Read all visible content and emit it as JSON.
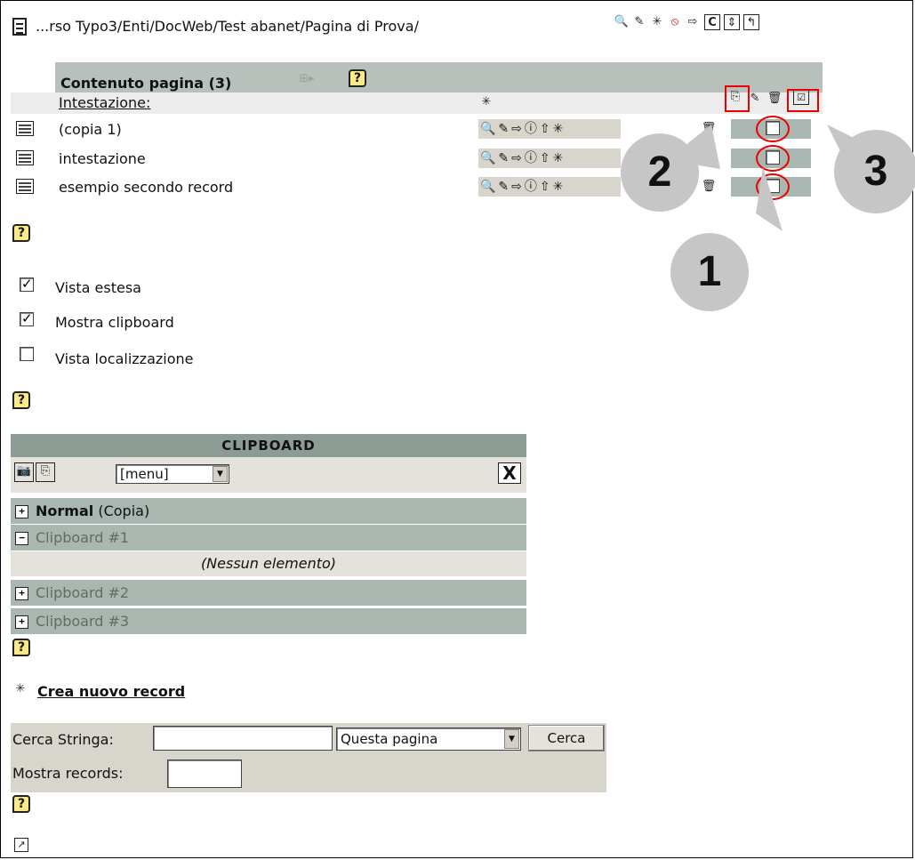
{
  "breadcrumb": {
    "path": "...rso Typo3/Enti/DocWeb/Test abanet/Pagina di Prova/"
  },
  "page_toolbar": {
    "icons": [
      "magnifier-icon",
      "pencil-icon",
      "new-record-icon",
      "edit-disabled-icon",
      "move-icon",
      "clear-cache-icon",
      "refresh-icon",
      "up-level-icon"
    ],
    "clear_cache_label": "C"
  },
  "content_table": {
    "title": "Contenuto pagina (3)",
    "column_header": "Intestazione:",
    "rows": [
      {
        "label": "(copia 1)"
      },
      {
        "label": "intestazione"
      },
      {
        "label": "esempio secondo record"
      }
    ]
  },
  "options": {
    "extended_view": {
      "label": "Vista estesa",
      "checked": true
    },
    "show_clipboard": {
      "label": "Mostra clipboard",
      "checked": true
    },
    "localization_view": {
      "label": "Vista localizzazione",
      "checked": false
    }
  },
  "clipboard": {
    "title": "CLIPBOARD",
    "menu_value": "[menu]",
    "close_label": "X",
    "normal_label": "Normal",
    "normal_mode": "(Copia)",
    "pad1": "Clipboard #1",
    "no_items": "(Nessun elemento)",
    "pad2": "Clipboard #2",
    "pad3": "Clipboard #3"
  },
  "new_record": {
    "label": "Crea nuovo record"
  },
  "search": {
    "label": "Cerca Stringa:",
    "value": "",
    "scope_value": "Questa pagina",
    "button": "Cerca",
    "show_records_label": "Mostra records:",
    "show_records_value": ""
  },
  "annotations": {
    "one": "1",
    "two": "2",
    "three": "3"
  },
  "colors": {
    "highlight": "#e00000",
    "header_band": "#b7c0bb",
    "clipboard_row": "#aab7b1",
    "clipboard_title": "#8c9b94"
  }
}
